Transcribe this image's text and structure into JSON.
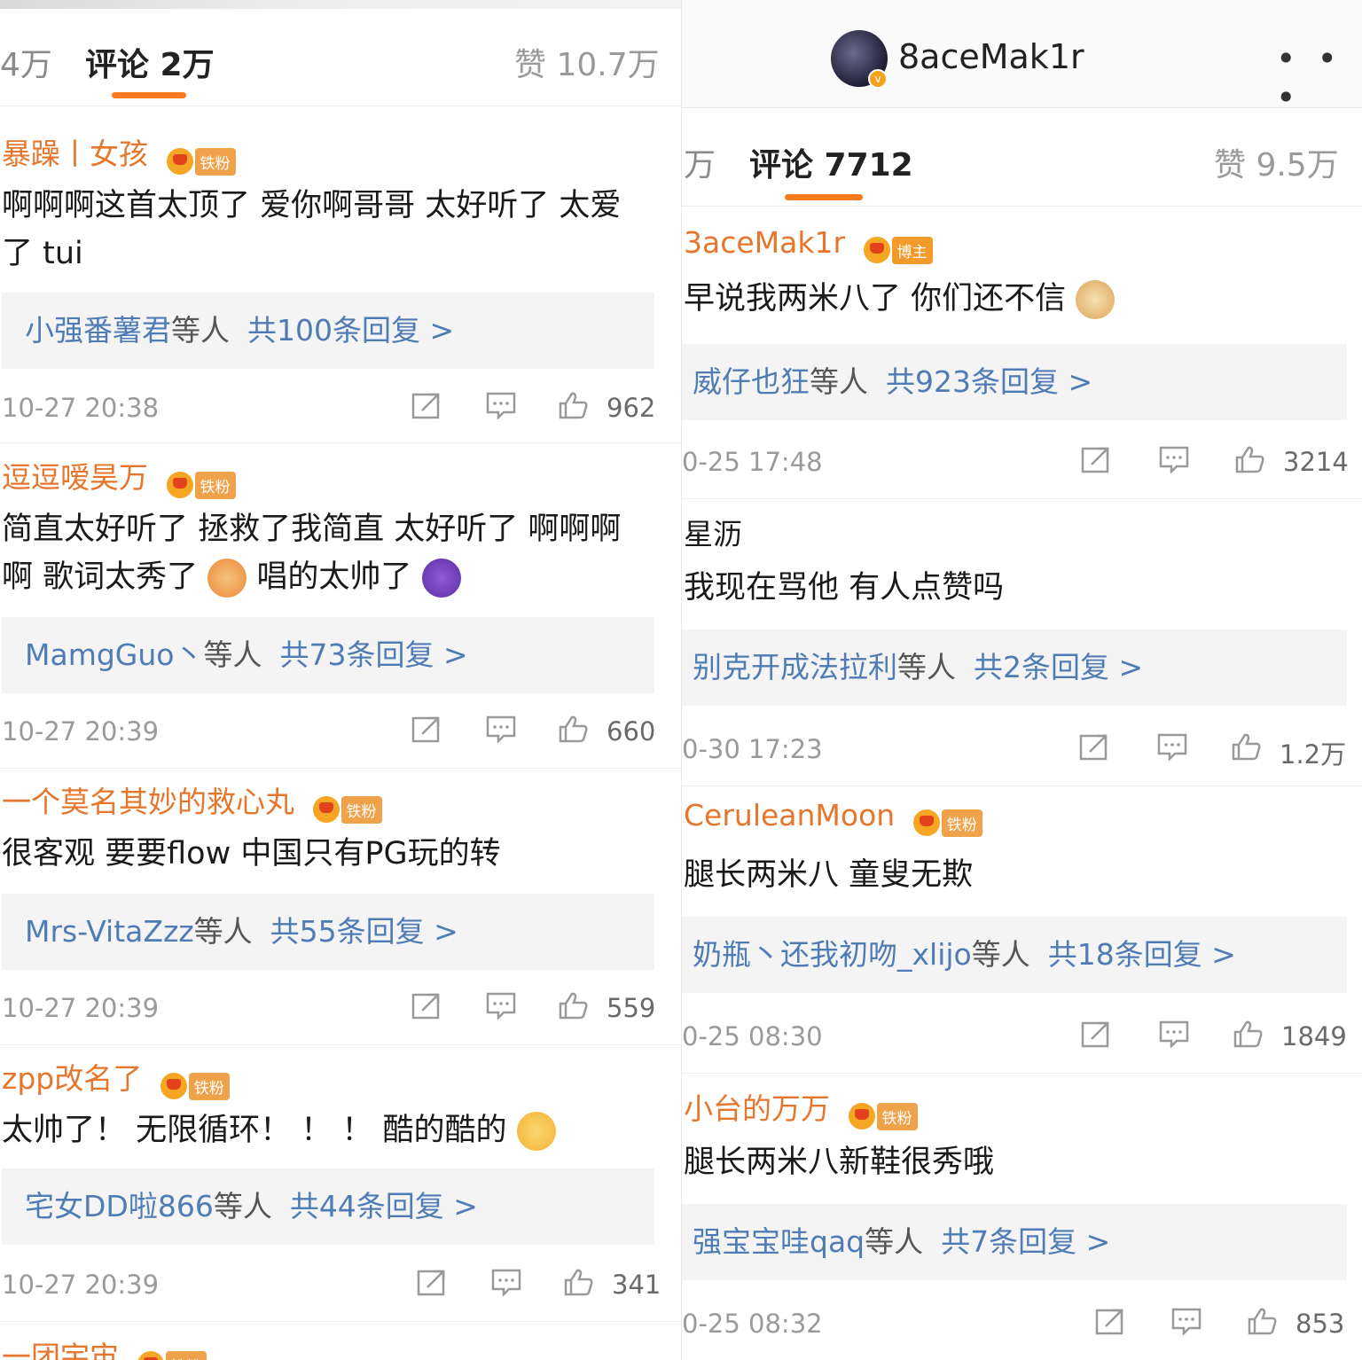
{
  "left": {
    "tabs": {
      "prev": "4万",
      "active": "评论 2万",
      "likes": "赞 10.7万"
    },
    "comments": [
      {
        "author": "暴躁丨女孩",
        "badge": "铁粉",
        "content": "啊啊啊这首太顶了 爱你啊哥哥 太好听了 太爱了 tui",
        "reply_users": "小强番薯君",
        "reply_and": "等人",
        "reply_count": "共100条回复 >",
        "time": "10-27 20:38",
        "likes": "962"
      },
      {
        "author": "逗逗嗳昊万",
        "badge": "铁粉",
        "content": "简直太好听了 拯救了我简直 太好听了 啊啊啊啊 歌词太秀了",
        "content_after": "唱的太帅了",
        "reply_users": "MamgGuo丶",
        "reply_and": "等人",
        "reply_count": "共73条回复 >",
        "time": "10-27 20:39",
        "likes": "660"
      },
      {
        "author": "一个莫名其妙的救心丸",
        "badge": "铁粉",
        "content": "很客观 要要flow 中国只有PG玩的转",
        "reply_users": "Mrs-VitaZzz",
        "reply_and": "等人",
        "reply_count": "共55条回复 >",
        "time": "10-27 20:39",
        "likes": "559"
      },
      {
        "author": "zpp改名了",
        "badge": "铁粉",
        "content": "太帅了！ 无限循环！ ！ ！ 酷的酷的",
        "reply_users": "宅女DD啦866",
        "reply_and": "等人",
        "reply_count": "共44条回复 >",
        "time": "10-27 20:39",
        "likes": "341"
      },
      {
        "author": "一团宇宙",
        "badge": "铁粉"
      }
    ]
  },
  "right": {
    "profile": {
      "name": "8aceMak1r",
      "badge_letter": "v",
      "more": "• • •"
    },
    "tabs": {
      "prev": "万",
      "active": "评论 7712",
      "likes": "赞 9.5万"
    },
    "comments": [
      {
        "author": "3aceMak1r",
        "badge": "博主",
        "content": "早说我两米八了 你们还不信",
        "reply_users": "威仔也狂",
        "reply_and": "等人",
        "reply_count": "共923条回复 >",
        "time": "0-25 17:48",
        "likes": "3214"
      },
      {
        "author": "星沥",
        "badge": "",
        "content": "我现在骂他 有人点赞吗",
        "reply_users": "别克开成法拉利",
        "reply_and": "等人",
        "reply_count": "共2条回复 >",
        "time": "0-30 17:23",
        "likes": "1.2万"
      },
      {
        "author": "CeruleanMoon",
        "badge": "铁粉",
        "content": "腿长两米八 童叟无欺",
        "reply_users": "奶瓶丶还我初吻_xlijo",
        "reply_and": "等人",
        "reply_count": "共18条回复 >",
        "time": "0-25 08:30",
        "likes": "1849"
      },
      {
        "author": "小台的万万",
        "badge": "铁粉",
        "content": "腿长两米八新鞋很秀哦",
        "reply_users": "强宝宝哇qaq",
        "reply_and": "等人",
        "reply_count": "共7条回复 >",
        "time": "0-25 08:32",
        "likes": "853"
      }
    ]
  },
  "colors": {
    "accent": "#f77b1e",
    "author": "#e5762b",
    "link": "#4f7cb5",
    "reply_bg": "#f4f4f4"
  },
  "icons": {
    "share": "share-icon",
    "comment": "comment-icon",
    "like": "thumbs-up-icon"
  }
}
